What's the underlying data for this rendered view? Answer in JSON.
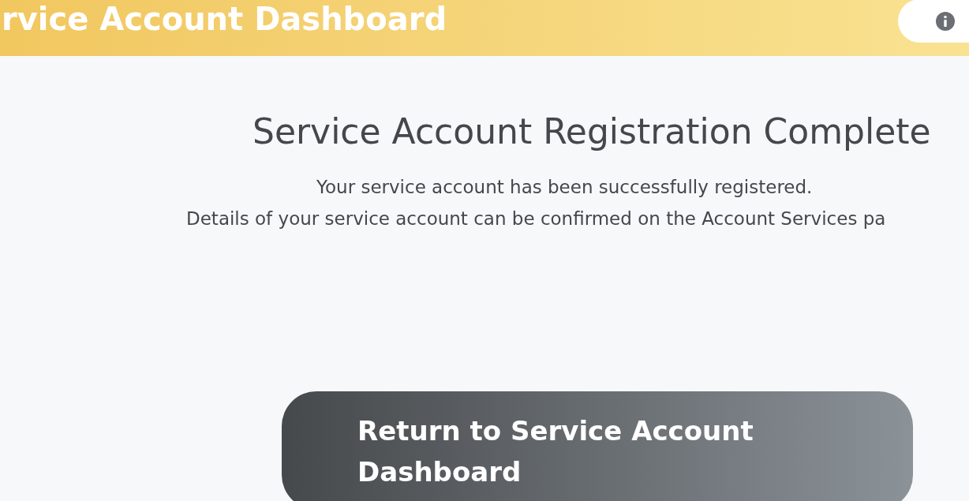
{
  "header": {
    "title": "rvice Account Dashboard"
  },
  "main": {
    "heading": "Service Account Registration Complete",
    "lines": [
      "Your service account has been successfully registered.",
      "Details of your service account can be confirmed on the Account Services pa"
    ],
    "button": "Return to Service Account Dashboard"
  }
}
